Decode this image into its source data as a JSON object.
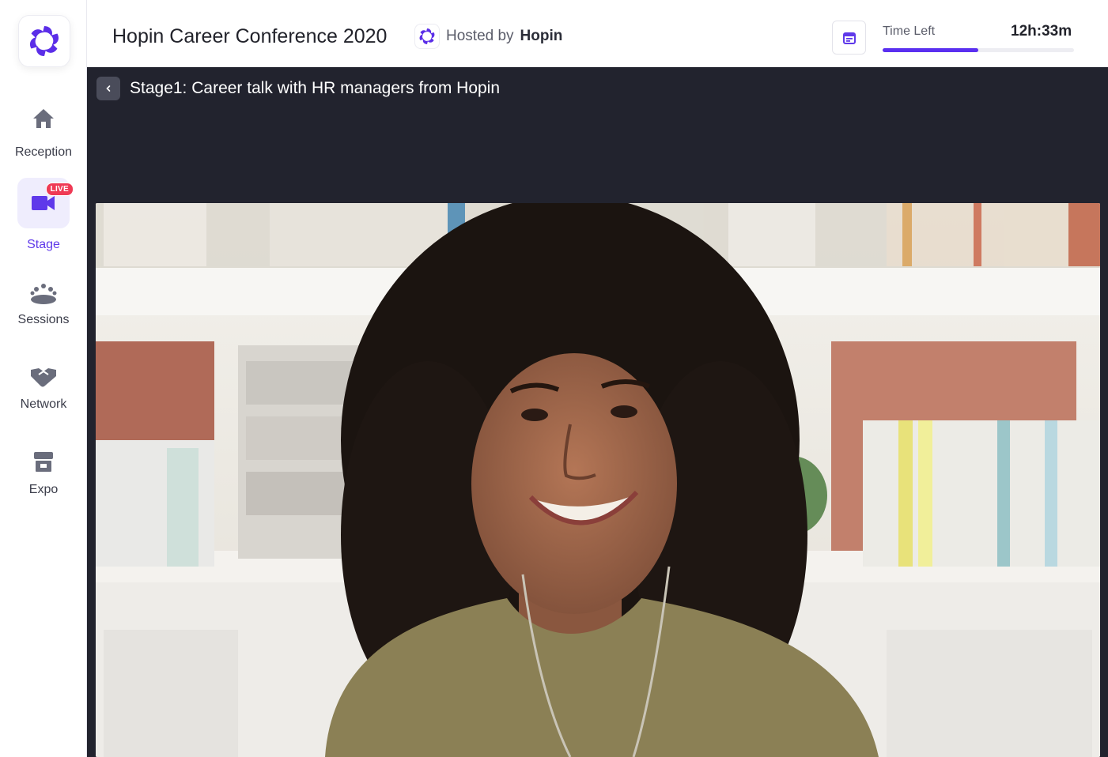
{
  "sidebar": {
    "items": [
      {
        "label": "Reception",
        "icon": "home-icon",
        "active": false
      },
      {
        "label": "Stage",
        "icon": "video-camera-icon",
        "active": true,
        "badge": "LIVE"
      },
      {
        "label": "Sessions",
        "icon": "group-icon",
        "active": false
      },
      {
        "label": "Network",
        "icon": "handshake-icon",
        "active": false
      },
      {
        "label": "Expo",
        "icon": "store-icon",
        "active": false
      }
    ]
  },
  "header": {
    "title": "Hopin Career Conference 2020",
    "hosted_prefix": "Hosted by",
    "host_name": "Hopin",
    "time_left_label": "Time Left",
    "time_left_value": "12h:33m",
    "time_progress": 0.5
  },
  "stage": {
    "title": "Stage1: Career talk with HR managers from Hopin"
  },
  "colors": {
    "accent": "#5f39ea",
    "stage_bg": "#22232e",
    "live": "#ef3a55"
  }
}
